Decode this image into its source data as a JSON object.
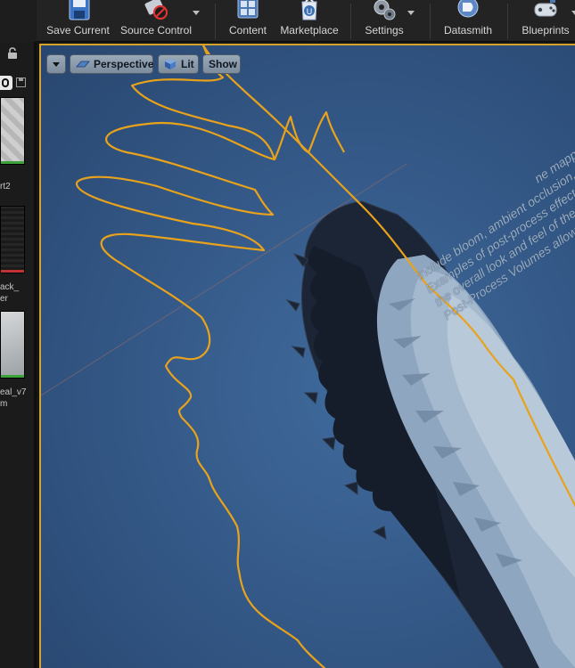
{
  "toolbar": {
    "buttons": [
      {
        "label": "Save Current",
        "icon": "save-icon"
      },
      {
        "label": "Source Control",
        "icon": "source-control-icon"
      },
      {
        "label": "Content",
        "icon": "content-icon"
      },
      {
        "label": "Marketplace",
        "icon": "marketplace-icon"
      },
      {
        "label": "Settings",
        "icon": "settings-icon"
      },
      {
        "label": "Datasmith",
        "icon": "datasmith-icon"
      },
      {
        "label": "Blueprints",
        "icon": "blueprints-icon"
      }
    ]
  },
  "sidebar": {
    "assets": [
      {
        "label": "rt2",
        "bar_color": "#3aa33a"
      },
      {
        "label": "ack_\ner",
        "bar_color": "#c23232"
      },
      {
        "label": "eal_v7\nm",
        "bar_color": "#3aa33a"
      }
    ]
  },
  "viewport": {
    "perspective_label": "Perspective",
    "lit_label": "Lit",
    "show_label": "Show",
    "text_lines": [
      "ne mapping",
      "include bloom, ambient occlusion, and",
      "Examples of post-process effects",
      "the overall look and feel of the sce",
      "Post-Process Volumes allow you t"
    ],
    "selection_color": "#e8a21b"
  }
}
